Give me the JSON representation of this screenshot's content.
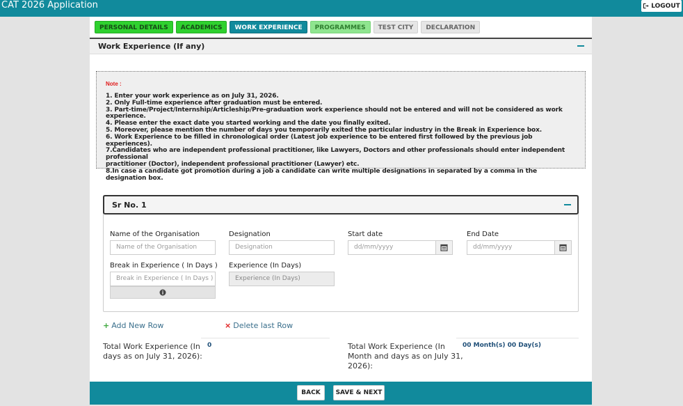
{
  "app": {
    "title": "CAT 2026 Application",
    "logout_label": "LOGOUT"
  },
  "tabs": [
    {
      "label": "PERSONAL DETAILS",
      "state": "done"
    },
    {
      "label": "ACADEMICS",
      "state": "done"
    },
    {
      "label": "WORK EXPERIENCE",
      "state": "active"
    },
    {
      "label": "PROGRAMMES",
      "state": "partial"
    },
    {
      "label": "TEST CITY",
      "state": "pending"
    },
    {
      "label": "DECLARATION",
      "state": "pending"
    }
  ],
  "section": {
    "title": "Work Experience (If any)"
  },
  "note": {
    "title": "Note :",
    "lines": [
      "1. Enter your work experience as on July 31, 2026.",
      "2. Only Full-time experience after graduation must be entered.",
      "3. Part-time/Project/Internship/Articleship/Pre-graduation work experience should not be entered and will not be considered as work experience.",
      "4. Please enter the exact date you started working and the date you finally exited.",
      "5. Moreover, please mention the number of days you temporarily exited the particular industry in the Break in Experience box.",
      "6. Work Experience to be filled in chronological order (Latest job experience to be entered first followed by the previous job experiences).",
      "7.Candidates who are independent professional practitioner, like Lawyers, Doctors and other professionals should enter independent professional",
      "practitioner (Doctor), independent professional practitioner (Lawyer) etc.",
      "8.In case a candidate got promotion during a job a candidate can write multiple designations in separated by a comma in the designation box."
    ]
  },
  "entry": {
    "title": "Sr No. 1",
    "org_label": "Name of the Organisation",
    "org_placeholder": "Name of the Organisation",
    "designation_label": "Designation",
    "designation_placeholder": "Designation",
    "start_label": "Start date",
    "start_placeholder": "dd/mm/yyyy",
    "end_label": "End Date",
    "end_placeholder": "dd/mm/yyyy",
    "break_label": "Break in Experience ( In Days )",
    "break_placeholder": "Break in Experience ( In Days )",
    "experience_label": "Experience (In Days)",
    "experience_placeholder": "Experience (In Days)"
  },
  "actions": {
    "add_row": "Add New Row",
    "delete_row": "Delete last Row"
  },
  "totals": {
    "days_label_1": "Total Work Experience (In",
    "days_label_2": "days as on July 31, 2026):",
    "days_value": "0",
    "months_label_1": "Total Work Experience (In",
    "months_label_2": "Month and days as on July 31,",
    "months_label_3": "2026):",
    "months_value": "00 Month(s) 00 Day(s)"
  },
  "footer": {
    "back_label": "BACK",
    "save_next_label": "SAVE & NEXT"
  },
  "colors": {
    "brand": "#118a9c",
    "tab_done": "#2fd12f",
    "note_title": "#e01b1b",
    "link": "#3a6f8c"
  },
  "icons": {
    "logout": "sign-out-icon",
    "calendar": "calendar-icon",
    "info": "info-circle-icon",
    "add": "plus-icon",
    "delete": "times-icon",
    "collapse": "minus-icon"
  }
}
